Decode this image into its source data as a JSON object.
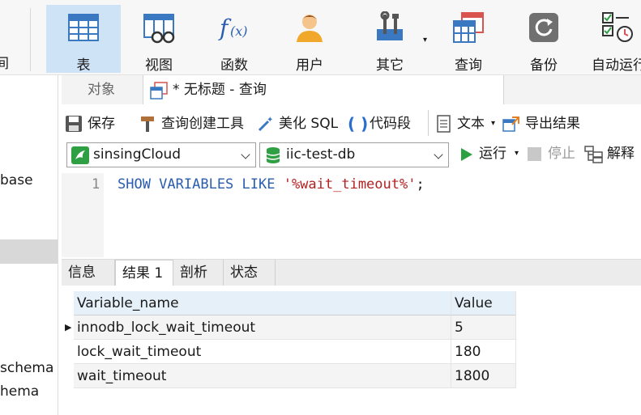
{
  "toolbar": {
    "left_partial_label": "间",
    "items": [
      {
        "label": "表",
        "icon": "table-icon",
        "active": true
      },
      {
        "label": "视图",
        "icon": "view-icon"
      },
      {
        "label": "函数",
        "icon": "function-icon"
      },
      {
        "label": "用户",
        "icon": "user-icon"
      },
      {
        "label": "其它",
        "icon": "tools-icon"
      },
      {
        "label": "查询",
        "icon": "query-icon"
      },
      {
        "label": "备份",
        "icon": "backup-icon"
      },
      {
        "label": "自动运行",
        "icon": "schedule-icon"
      }
    ]
  },
  "sidebar": {
    "items": [
      "base",
      "schema",
      "hema"
    ]
  },
  "tabs": {
    "objects": "对象",
    "query_tab": "* 无标题 - 查询"
  },
  "actions": {
    "save": "保存",
    "query_builder": "查询创建工具",
    "beautify": "美化 SQL",
    "snippet": "代码段",
    "text": "文本",
    "export": "导出结果"
  },
  "selectors": {
    "connection": "sinsingCloud",
    "database": "iic-test-db"
  },
  "run_controls": {
    "run": "运行",
    "stop": "停止",
    "explain": "解释"
  },
  "editor": {
    "line_number": "1",
    "keywords": "SHOW VARIABLES LIKE ",
    "string": "'%wait_timeout%'",
    "terminator": ";"
  },
  "result_tabs": [
    "信息",
    "结果 1",
    "剖析",
    "状态"
  ],
  "result_grid": {
    "columns": [
      "Variable_name",
      "Value"
    ],
    "rows": [
      [
        "innodb_lock_wait_timeout",
        "5"
      ],
      [
        "lock_wait_timeout",
        "180"
      ],
      [
        "wait_timeout",
        "1800"
      ]
    ]
  },
  "colors": {
    "keyword": "#2a5db0",
    "string": "#b22222",
    "accent": "#cfe3f7",
    "run_green": "#2ea043"
  }
}
